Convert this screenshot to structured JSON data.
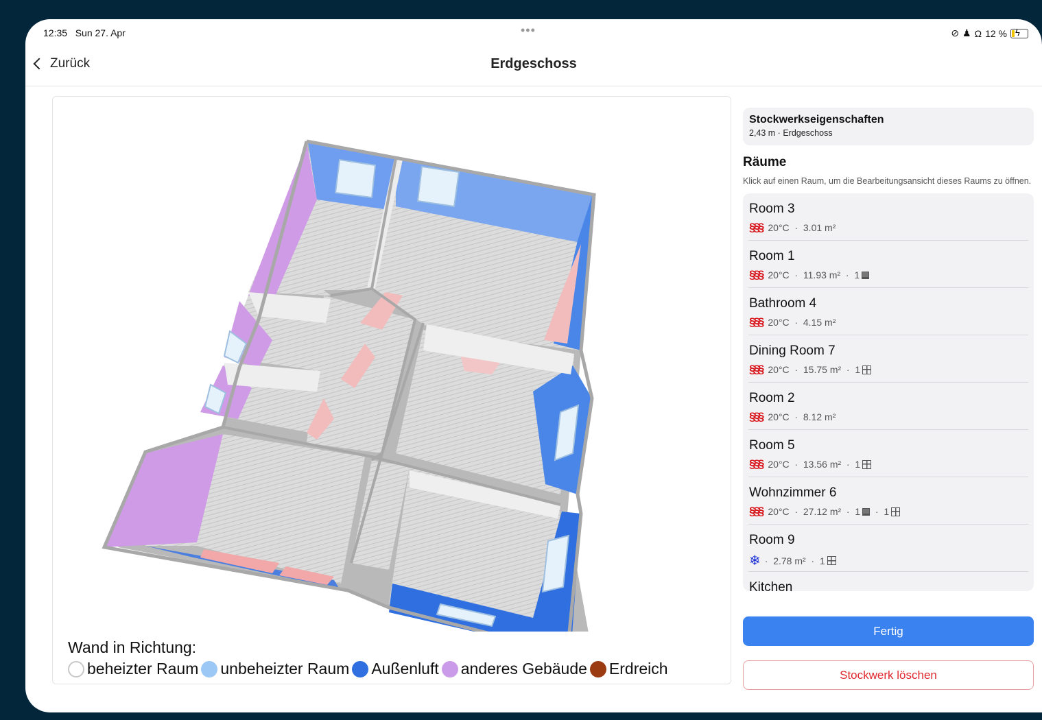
{
  "status_bar": {
    "time": "12:35",
    "date": "Sun 27. Apr",
    "dots": "•••",
    "battery": "12 %"
  },
  "nav": {
    "back_label": "Zurück",
    "title": "Erdgeschoss"
  },
  "properties": {
    "title": "Stockwerkseigenschaften",
    "subtitle": "2,43 m · Erdgeschoss"
  },
  "rooms_section": {
    "title": "Räume",
    "hint": "Klick auf einen Raum, um die Bearbeitungsansicht dieses Raums zu öffnen.",
    "rooms": [
      {
        "name": "Room 3",
        "icon": "heating-icon",
        "temp": "20°C",
        "area": "3.01 m²",
        "doors": "",
        "windows": ""
      },
      {
        "name": "Room 1",
        "icon": "heating-icon",
        "temp": "20°C",
        "area": "11.93 m²",
        "doors": "1",
        "windows": ""
      },
      {
        "name": "Bathroom 4",
        "icon": "heating-icon",
        "temp": "20°C",
        "area": "4.15 m²",
        "doors": "",
        "windows": ""
      },
      {
        "name": "Dining Room 7",
        "icon": "heating-icon",
        "temp": "20°C",
        "area": "15.75 m²",
        "doors": "",
        "windows": "1"
      },
      {
        "name": "Room 2",
        "icon": "heating-icon",
        "temp": "20°C",
        "area": "8.12 m²",
        "doors": "",
        "windows": ""
      },
      {
        "name": "Room 5",
        "icon": "heating-icon",
        "temp": "20°C",
        "area": "13.56 m²",
        "doors": "",
        "windows": "1"
      },
      {
        "name": "Wohnzimmer 6",
        "icon": "heating-icon",
        "temp": "20°C",
        "area": "27.12 m²",
        "doors": "1",
        "windows": "1"
      },
      {
        "name": "Room 9",
        "icon": "snowflake-icon",
        "temp": "",
        "area": "2.78 m²",
        "doors": "",
        "windows": "1"
      },
      {
        "name": "Kitchen",
        "icon": "",
        "temp": "",
        "area": "",
        "doors": "",
        "windows": ""
      }
    ]
  },
  "buttons": {
    "done": "Fertig",
    "delete": "Stockwerk löschen"
  },
  "legend": {
    "title": "Wand in Richtung:",
    "items": [
      {
        "label": "beheizter Raum",
        "color": "#ffffff"
      },
      {
        "label": "unbeheizter Raum",
        "color": "#9cc8f5"
      },
      {
        "label": "Außenluft",
        "color": "#2f6fe0"
      },
      {
        "label": "anderes Gebäude",
        "color": "#c99be8"
      },
      {
        "label": "Erdreich",
        "color": "#9a3b12"
      }
    ]
  },
  "colors": {
    "accent": "#3b82f1",
    "danger": "#e0282e",
    "heated_wall": "#f2bcbc",
    "exterior_wall": "#4a86e8",
    "other_building_wall": "#cf9be6",
    "floor": "#d7d7d7"
  }
}
